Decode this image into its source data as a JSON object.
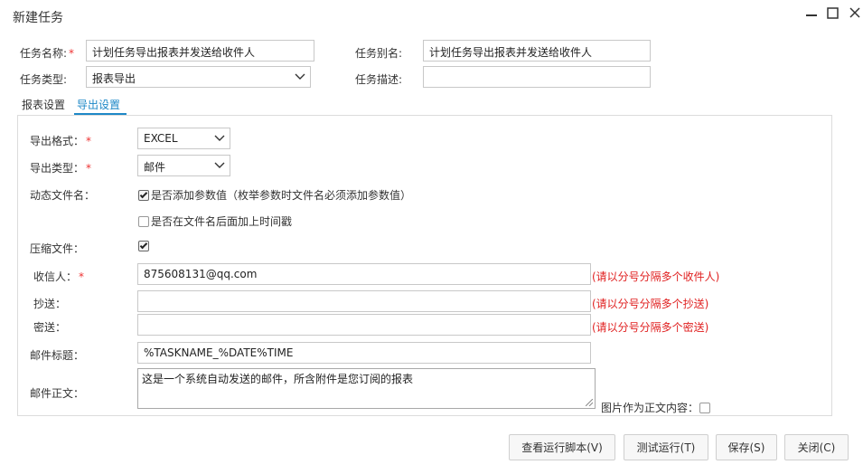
{
  "window": {
    "title": "新建任务",
    "minimize_icon": "minimize-icon",
    "maximize_icon": "maximize-icon",
    "close_icon": "close-icon"
  },
  "header_form": {
    "task_name_label": "任务名称:",
    "task_name_value": "计划任务导出报表并发送给收件人",
    "task_alias_label": "任务别名:",
    "task_alias_value": "计划任务导出报表并发送给收件人",
    "task_type_label": "任务类型:",
    "task_type_value": "报表导出",
    "task_desc_label": "任务描述:",
    "task_desc_value": ""
  },
  "tabs": [
    {
      "label": "报表设置",
      "active": false
    },
    {
      "label": "导出设置",
      "active": true
    }
  ],
  "export": {
    "format_label": "导出格式：",
    "format_value": "EXCEL",
    "type_label": "导出类型：",
    "type_value": "邮件",
    "dynamic_filename_label": "动态文件名：",
    "add_param_label": "是否添加参数值（枚举参数时文件名必须添加参数值）",
    "add_param_checked": true,
    "add_timestamp_label": "是否在文件名后面加上时间戳",
    "add_timestamp_checked": false,
    "compress_label": "压缩文件：",
    "compress_checked": true,
    "recipient_label": "收信人：",
    "recipient_value": "875608131@qq.com",
    "recipient_hint": "(请以分号分隔多个收件人)",
    "cc_label": "抄送：",
    "cc_value": "",
    "cc_hint": "(请以分号分隔多个抄送)",
    "bcc_label": "密送：",
    "bcc_value": "",
    "bcc_hint": "(请以分号分隔多个密送)",
    "subject_label": "邮件标题：",
    "subject_value": "%TASKNAME_%DATE%TIME",
    "body_label": "邮件正文：",
    "body_value": "这是一个系统自动发送的邮件，所含附件是您订阅的报表",
    "image_as_body_label": "图片作为正文内容：",
    "image_as_body_checked": false
  },
  "buttons": {
    "view_script": "查看运行脚本(V)",
    "test_run": "测试运行(T)",
    "save": "保存(S)",
    "close": "关闭(C)"
  },
  "colors": {
    "active_tab": "#1e88c7",
    "required": "#e33333",
    "hint": "#e02020"
  }
}
